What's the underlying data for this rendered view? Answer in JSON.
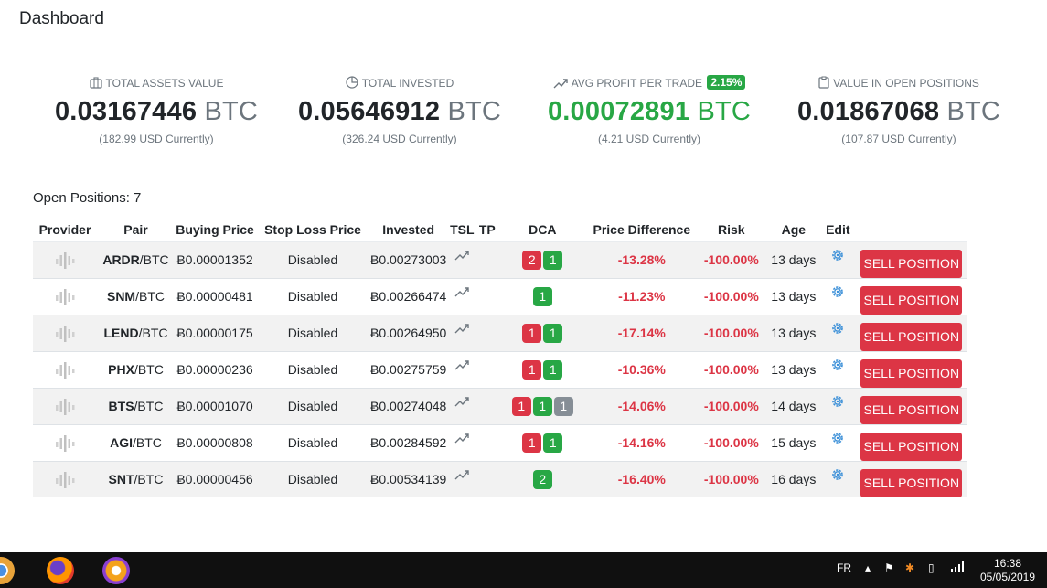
{
  "page": {
    "title": "Dashboard"
  },
  "stats": [
    {
      "label": "TOTAL ASSETS VALUE",
      "icon": "briefcase-icon",
      "amount": "0.03167446",
      "unit": "BTC",
      "sub": "(182.99 USD Currently)"
    },
    {
      "label": "TOTAL INVESTED",
      "icon": "pie-chart-icon",
      "amount": "0.05646912",
      "unit": "BTC",
      "sub": "(326.24 USD Currently)"
    },
    {
      "label": "AVG PROFIT PER TRADE",
      "icon": "trending-up-icon",
      "badge": "2.15%",
      "amount": "0.00072891",
      "unit": "BTC",
      "sub": "(4.21 USD Currently)"
    },
    {
      "label": "VALUE IN OPEN POSITIONS",
      "icon": "clipboard-icon",
      "amount": "0.01867068",
      "unit": "BTC",
      "sub": "(107.87 USD Currently)"
    }
  ],
  "open_positions_label": "Open Positions: 7",
  "table": {
    "headers": [
      "Provider",
      "Pair",
      "Buying Price",
      "Stop Loss Price",
      "Invested",
      "TSL",
      "TP",
      "DCA",
      "Price Difference",
      "Risk",
      "Age",
      "Edit",
      ""
    ],
    "sell_label": "SELL POSITION",
    "rows": [
      {
        "base": "ARDR",
        "quote": "/BTC",
        "buy": "Ƀ0.00001352",
        "stop": "Disabled",
        "invested": "Ƀ0.00273003",
        "dca": [
          {
            "n": "2",
            "c": "r"
          },
          {
            "n": "1",
            "c": "g"
          }
        ],
        "diff": "-13.28%",
        "risk": "-100.00%",
        "age": "13 days"
      },
      {
        "base": "SNM",
        "quote": "/BTC",
        "buy": "Ƀ0.00000481",
        "stop": "Disabled",
        "invested": "Ƀ0.00266474",
        "dca": [
          {
            "n": "1",
            "c": "g"
          }
        ],
        "diff": "-11.23%",
        "risk": "-100.00%",
        "age": "13 days"
      },
      {
        "base": "LEND",
        "quote": "/BTC",
        "buy": "Ƀ0.00000175",
        "stop": "Disabled",
        "invested": "Ƀ0.00264950",
        "dca": [
          {
            "n": "1",
            "c": "r"
          },
          {
            "n": "1",
            "c": "g"
          }
        ],
        "diff": "-17.14%",
        "risk": "-100.00%",
        "age": "13 days"
      },
      {
        "base": "PHX",
        "quote": "/BTC",
        "buy": "Ƀ0.00000236",
        "stop": "Disabled",
        "invested": "Ƀ0.00275759",
        "dca": [
          {
            "n": "1",
            "c": "r"
          },
          {
            "n": "1",
            "c": "g"
          }
        ],
        "diff": "-10.36%",
        "risk": "-100.00%",
        "age": "13 days"
      },
      {
        "base": "BTS",
        "quote": "/BTC",
        "buy": "Ƀ0.00001070",
        "stop": "Disabled",
        "invested": "Ƀ0.00274048",
        "dca": [
          {
            "n": "1",
            "c": "r"
          },
          {
            "n": "1",
            "c": "g"
          },
          {
            "n": "1",
            "c": "s"
          }
        ],
        "diff": "-14.06%",
        "risk": "-100.00%",
        "age": "14 days"
      },
      {
        "base": "AGI",
        "quote": "/BTC",
        "buy": "Ƀ0.00000808",
        "stop": "Disabled",
        "invested": "Ƀ0.00284592",
        "dca": [
          {
            "n": "1",
            "c": "r"
          },
          {
            "n": "1",
            "c": "g"
          }
        ],
        "diff": "-14.16%",
        "risk": "-100.00%",
        "age": "15 days"
      },
      {
        "base": "SNT",
        "quote": "/BTC",
        "buy": "Ƀ0.00000456",
        "stop": "Disabled",
        "invested": "Ƀ0.00534139",
        "dca": [
          {
            "n": "2",
            "c": "g"
          }
        ],
        "diff": "-16.40%",
        "risk": "-100.00%",
        "age": "16 days"
      }
    ]
  },
  "taskbar": {
    "lang": "FR",
    "time": "16:38",
    "date": "05/05/2019"
  },
  "colors": {
    "danger": "#dc3545",
    "success": "#28a745",
    "secondary": "#868e96",
    "muted": "#6c757d",
    "gear": "#3a8fd8"
  }
}
